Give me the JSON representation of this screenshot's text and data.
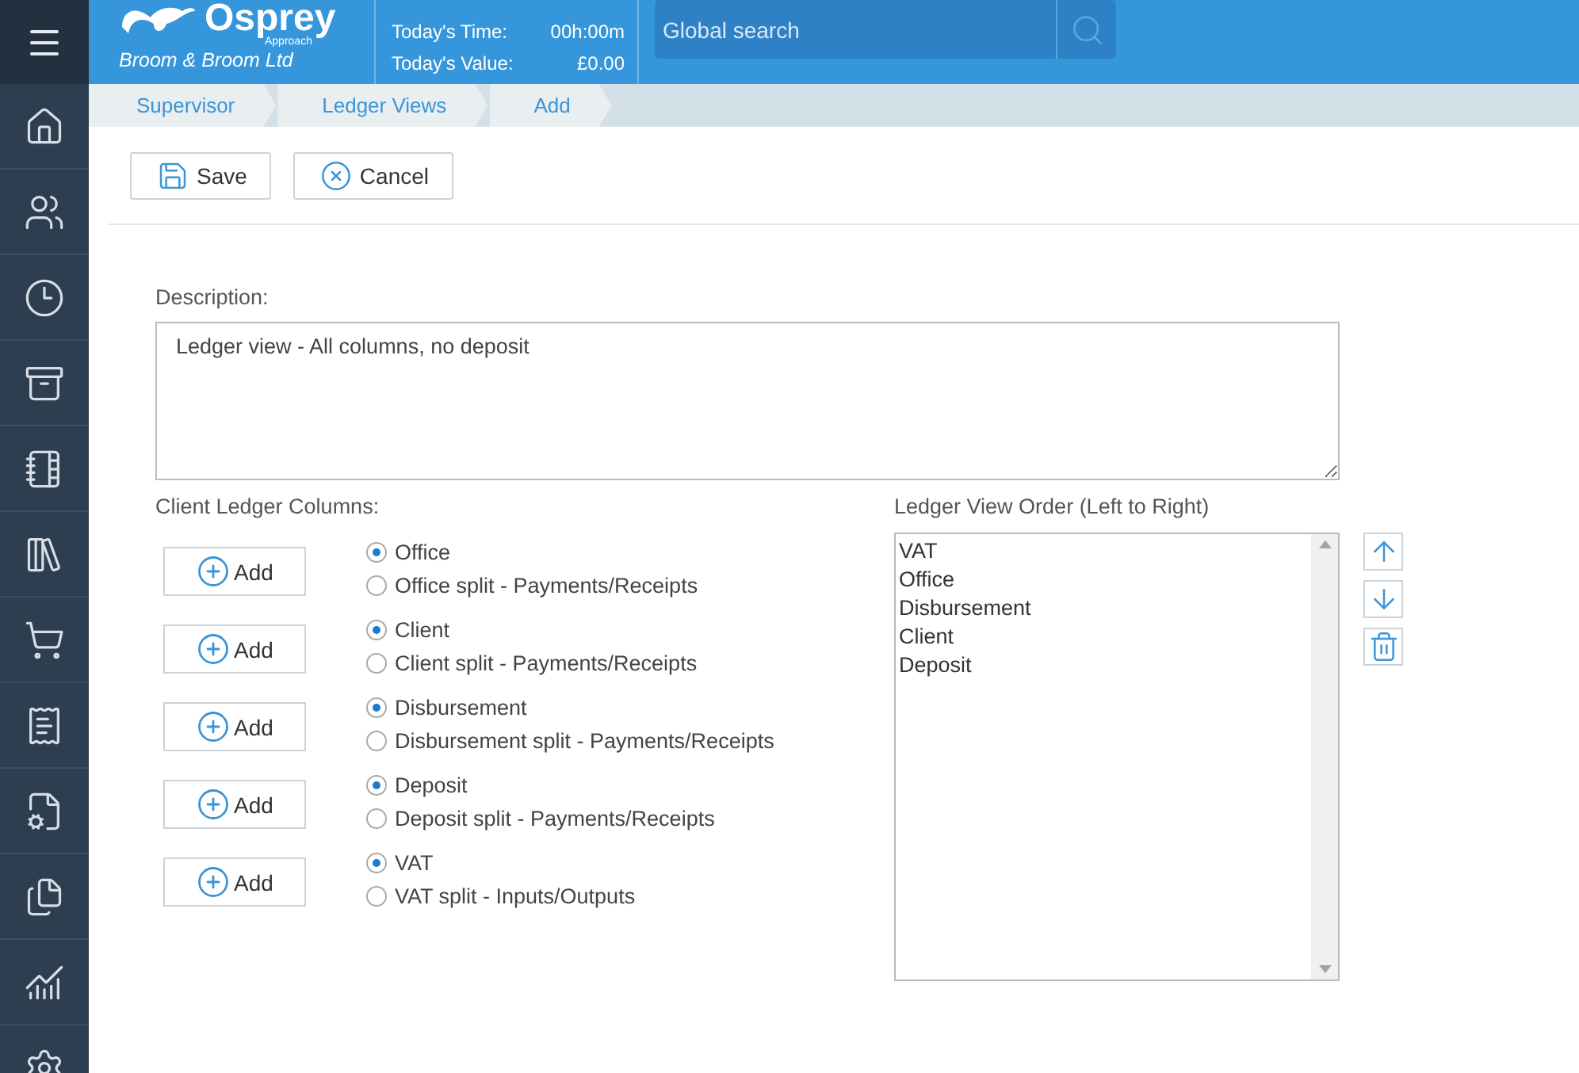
{
  "header": {
    "brand": "Osprey",
    "brand_sub": "Approach",
    "company": "Broom & Broom Ltd",
    "stats": [
      {
        "label": "Today's Time:",
        "value": "00h:00m"
      },
      {
        "label": "Today's Value:",
        "value": "£0.00"
      }
    ],
    "search": {
      "placeholder": "Global search"
    }
  },
  "breadcrumb": [
    "Supervisor",
    "Ledger Views",
    "Add"
  ],
  "toolbar": [
    "Save",
    "Cancel"
  ],
  "form": {
    "description_label": "Description:",
    "description_value": "Ledger view - All columns, no deposit",
    "columns_label": "Client Ledger Columns:",
    "columns": [
      {
        "button": "Add",
        "options": [
          {
            "label": "Office",
            "selected": true
          },
          {
            "label": "Office split - Payments/Receipts",
            "selected": false
          }
        ]
      },
      {
        "button": "Add",
        "options": [
          {
            "label": "Client",
            "selected": true
          },
          {
            "label": "Client split - Payments/Receipts",
            "selected": false
          }
        ]
      },
      {
        "button": "Add",
        "options": [
          {
            "label": "Disbursement",
            "selected": true
          },
          {
            "label": "Disbursement split - Payments/Receipts",
            "selected": false
          }
        ]
      },
      {
        "button": "Add",
        "options": [
          {
            "label": "Deposit",
            "selected": true
          },
          {
            "label": "Deposit split - Payments/Receipts",
            "selected": false
          }
        ]
      },
      {
        "button": "Add",
        "options": [
          {
            "label": "VAT",
            "selected": true
          },
          {
            "label": "VAT split - Inputs/Outputs",
            "selected": false
          }
        ]
      }
    ],
    "order_label": "Ledger View Order (Left to Right)",
    "order": [
      "VAT",
      "Office",
      "Disbursement",
      "Client",
      "Deposit"
    ]
  }
}
